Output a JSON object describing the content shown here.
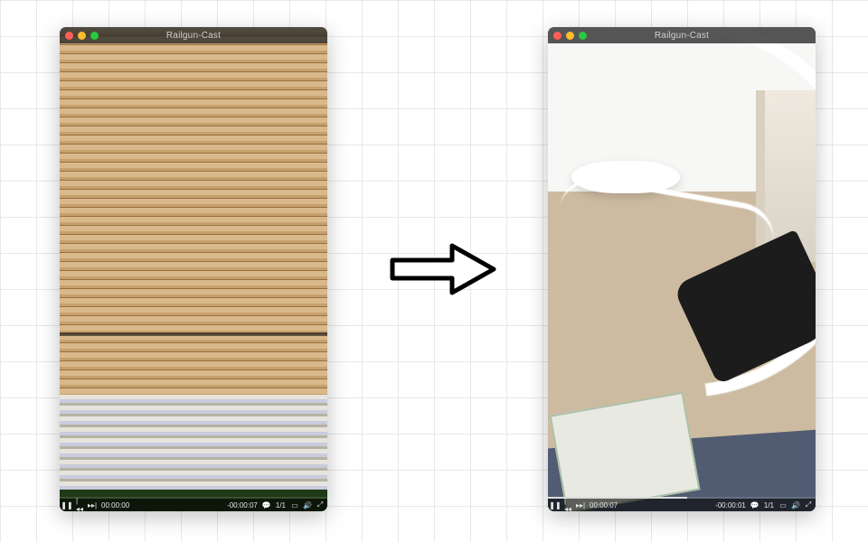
{
  "left": {
    "title": "Railgun-Cast",
    "controls": {
      "play_icon": "❚❚",
      "prev_icon": "|◂◂",
      "next_icon": "▸▸|",
      "elapsed": "00:00:00",
      "remaining": "-00:00:07",
      "chapter_icon": "💬",
      "chapter": "1/1",
      "window_icon": "▭",
      "volume_icon": "🔊",
      "fullscreen_icon": "⤢"
    }
  },
  "right": {
    "title": "Railgun-Cast",
    "controls": {
      "play_icon": "❚❚",
      "prev_icon": "|◂◂",
      "next_icon": "▸▸|",
      "elapsed": "00:00:07",
      "remaining": "-00:00:01",
      "chapter_icon": "💬",
      "chapter": "1/1",
      "window_icon": "▭",
      "volume_icon": "🔊",
      "fullscreen_icon": "⤢"
    }
  },
  "colors": {
    "traffic_red": "#ff5f57",
    "traffic_yellow": "#febc2e",
    "traffic_green": "#28c840"
  }
}
